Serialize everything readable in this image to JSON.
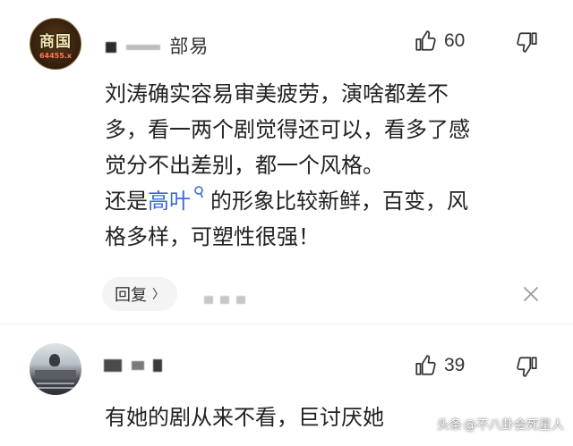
{
  "comments": [
    {
      "avatar_badge": "商国",
      "avatar_sub": "64455.x",
      "username_visible": "部易",
      "likes": "60",
      "body_lines": [
        "刘涛确实容易审美疲劳，演啥都差不",
        "多，看一两个剧觉得还可以，看多了感",
        "觉分不出差别，都一个风格。"
      ],
      "body_line4_before": "还是",
      "body_line4_link": "高叶",
      "body_line4_after": "的形象比较新鲜，百变，风",
      "body_line5": "格多样，可塑性很强！",
      "reply_label": "回复",
      "reply_chevron": "〉"
    },
    {
      "likes": "39",
      "body_line1": "有她的剧从来不看，巨讨厌她"
    }
  ],
  "watermark": {
    "prefix": "头条",
    "text": "@不八卦会死星人"
  },
  "colors": {
    "link": "#3d6bd3",
    "text": "#222222",
    "reply_bg": "#f4f4f4"
  },
  "icons": [
    "thumb-up-icon",
    "thumb-down-icon",
    "close-icon",
    "search-link-icon",
    "chevron-right-icon"
  ]
}
